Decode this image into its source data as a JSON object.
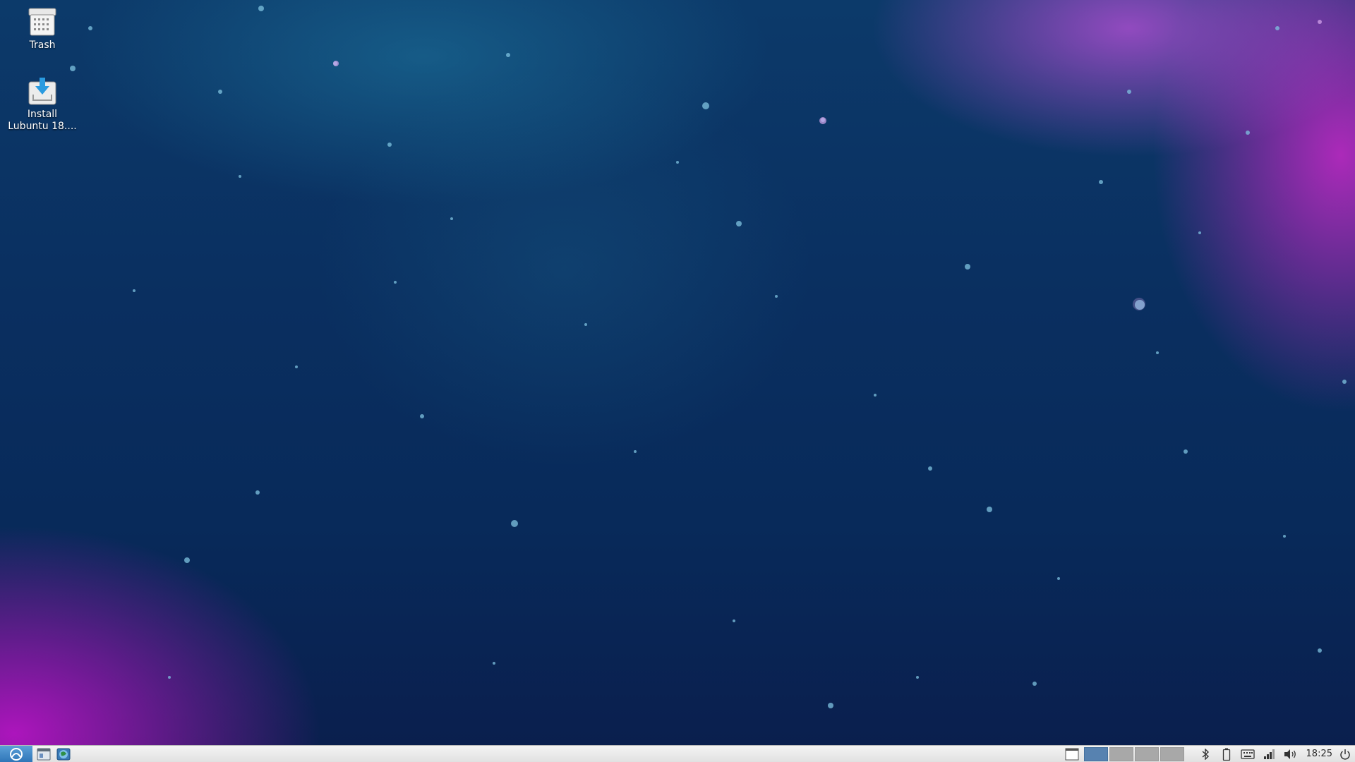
{
  "desktop": {
    "icons": [
      {
        "label": "Trash",
        "icon": "trash-icon"
      },
      {
        "label_line1": "Install",
        "label_line2": "Lubuntu 18....",
        "icon": "installer-icon"
      }
    ]
  },
  "taskbar": {
    "start_icon": "lubuntu-logo-icon",
    "launchers": [
      "file-manager-icon",
      "web-browser-icon"
    ],
    "show_desktop_icon": "show-desktop-icon",
    "workspaces": [
      {
        "index": 1,
        "active": true
      },
      {
        "index": 2,
        "active": false
      },
      {
        "index": 3,
        "active": false
      },
      {
        "index": 4,
        "active": false
      }
    ],
    "tray": [
      "bluetooth-icon",
      "battery-icon",
      "keyboard-icon",
      "network-signal-icon",
      "volume-icon"
    ],
    "clock": "18:25",
    "power_icon": "power-icon"
  },
  "colors": {
    "taskbar_bg": "#e6e6e6",
    "start_button": "#3b84c4",
    "active_workspace": "#5782b0",
    "inactive_workspace": "#a8a8a8"
  }
}
